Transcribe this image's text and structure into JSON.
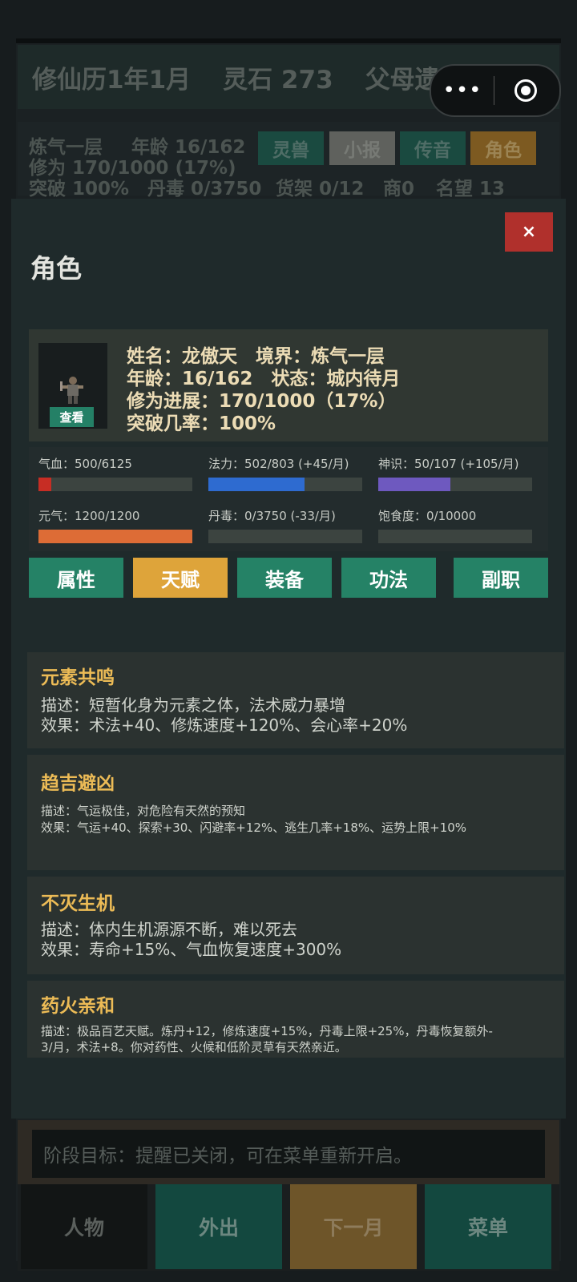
{
  "topbar": {
    "calendar": "修仙历1年1月",
    "spirit_stones": "灵石 273",
    "event": "父母遗赠",
    "capsule_more": "•••"
  },
  "status": {
    "realm": "炼气一层",
    "age": "年龄 16/162",
    "cultivation": "修为 170/1000 (17%)",
    "breakthrough": "突破 100%",
    "poison": "丹毒 0/3750",
    "shelf": "货架 0/12",
    "merchant": "商0",
    "fame": "名望 13"
  },
  "quick_buttons": [
    {
      "label": "灵兽",
      "color": "#1a4a40"
    },
    {
      "label": "小报",
      "color": "#5f615d"
    },
    {
      "label": "传音",
      "color": "#1a4a40"
    },
    {
      "label": "角色",
      "color": "#7d5a21"
    }
  ],
  "modal": {
    "title": "角色",
    "close": "×",
    "avatar_button": "查看",
    "info": {
      "line1": "姓名：龙傲天　境界：炼气一层",
      "line2": "年龄：16/162　状态：城内待月",
      "line3": "修为进展：170/1000（17%）",
      "line4": "突破几率：100%"
    },
    "bars": [
      {
        "label": "气血：500/6125",
        "fraction": 0.082,
        "color": "#c72d24"
      },
      {
        "label": "法力：502/803 (+45/月)",
        "fraction": 0.625,
        "color": "#2e6bd0"
      },
      {
        "label": "神识：50/107 (+105/月)",
        "fraction": 0.467,
        "color": "#6e59bf"
      },
      {
        "label": "元气：1200/1200",
        "fraction": 1.0,
        "color": "#dd6c36"
      },
      {
        "label": "丹毒：0/3750 (-33/月)",
        "fraction": 0,
        "color": "#c72d24"
      },
      {
        "label": "饱食度：0/10000",
        "fraction": 0,
        "color": "#c72d24"
      }
    ],
    "tabs": [
      {
        "label": "属性",
        "active": false
      },
      {
        "label": "天赋",
        "active": true
      },
      {
        "label": "装备",
        "active": false
      },
      {
        "label": "功法",
        "active": false
      },
      {
        "label": "副职",
        "active": false
      }
    ],
    "talents": [
      {
        "name": "元素共鸣",
        "desc": "描述：短暂化身为元素之体，法术威力暴增",
        "effect": "效果：术法+40、修炼速度+120%、会心率+20%"
      },
      {
        "name": "趋吉避凶",
        "desc": "描述：气运极佳，对危险有天然的预知",
        "effect": "效果：气运+40、探索+30、闪避率+12%、逃生几率+18%、运势上限+10%"
      },
      {
        "name": "不灭生机",
        "desc": "描述：体内生机源源不断，难以死去",
        "effect": "效果：寿命+15%、气血恢复速度+300%"
      },
      {
        "name": "药火亲和",
        "desc": "描述：极品百艺天赋。炼丹+12，修炼速度+15%，丹毒上限+25%，丹毒恢复额外-",
        "effect": "3/月，术法+8。你对药性、火候和低阶灵草有天然亲近。"
      }
    ]
  },
  "goal": "阶段目标：提醒已关闭，可在菜单重新开启。",
  "nav": [
    {
      "label": "人物",
      "bg": "#121515",
      "fg": "#5b605d"
    },
    {
      "label": "外出",
      "bg": "#13483f",
      "fg": "#6c8780"
    },
    {
      "label": "下一月",
      "bg": "#6e5529",
      "fg": "#8e7c5c"
    },
    {
      "label": "菜单",
      "bg": "#13483f",
      "fg": "#6c8780"
    }
  ]
}
